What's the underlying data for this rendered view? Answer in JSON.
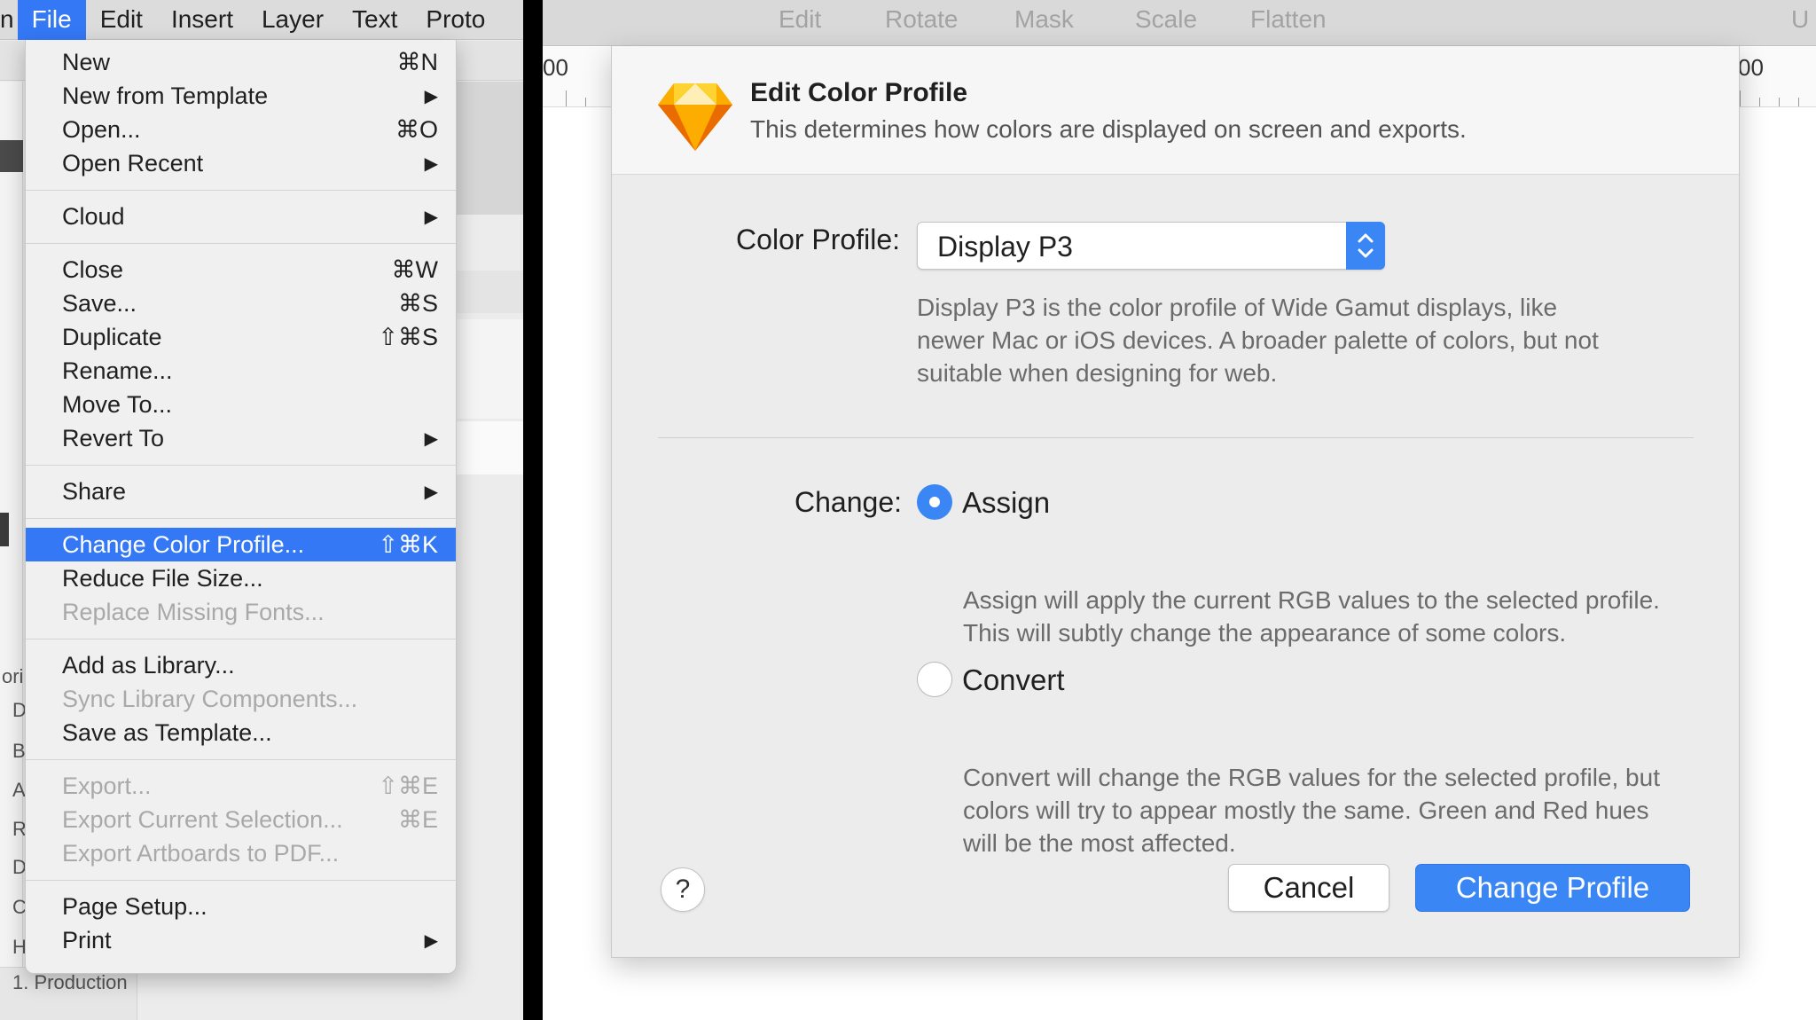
{
  "menubar": {
    "items": [
      {
        "label": "n"
      },
      {
        "label": "File"
      },
      {
        "label": "Edit"
      },
      {
        "label": "Insert"
      },
      {
        "label": "Layer"
      },
      {
        "label": "Text"
      },
      {
        "label": "Proto"
      }
    ]
  },
  "file_menu": {
    "groups": [
      [
        {
          "label": "New",
          "shortcut": "⌘N"
        },
        {
          "label": "New from Template",
          "submenu": "▶"
        },
        {
          "label": "Open...",
          "shortcut": "⌘O"
        },
        {
          "label": "Open Recent",
          "submenu": "▶"
        }
      ],
      [
        {
          "label": "Cloud",
          "submenu": "▶"
        }
      ],
      [
        {
          "label": "Close",
          "shortcut": "⌘W"
        },
        {
          "label": "Save...",
          "shortcut": "⌘S"
        },
        {
          "label": "Duplicate",
          "shortcut": "⇧⌘S"
        },
        {
          "label": "Rename..."
        },
        {
          "label": "Move To..."
        },
        {
          "label": "Revert To",
          "submenu": "▶"
        }
      ],
      [
        {
          "label": "Share",
          "submenu": "▶"
        }
      ],
      [
        {
          "label": "Change Color Profile...",
          "shortcut": "⇧⌘K",
          "highlight": true
        },
        {
          "label": "Reduce File Size..."
        },
        {
          "label": "Replace Missing Fonts...",
          "disabled": true
        }
      ],
      [
        {
          "label": "Add as Library..."
        },
        {
          "label": "Sync Library Components...",
          "disabled": true
        },
        {
          "label": "Save as Template..."
        }
      ],
      [
        {
          "label": "Export...",
          "shortcut": "⇧⌘E",
          "disabled": true
        },
        {
          "label": "Export Current Selection...",
          "shortcut": "⌘E",
          "disabled": true
        },
        {
          "label": "Export Artboards to PDF...",
          "disabled": true
        }
      ],
      [
        {
          "label": "Page Setup..."
        },
        {
          "label": "Print",
          "submenu": "▶"
        }
      ]
    ]
  },
  "background": {
    "layer_fragments": [
      "ori",
      "D",
      "B",
      "A",
      "R",
      "D",
      "C",
      "H"
    ],
    "production_label": "1. Production"
  },
  "toolbar": {
    "items": [
      "Edit",
      "Rotate",
      "Mask",
      "Scale",
      "Flatten",
      "U"
    ]
  },
  "ruler": {
    "left_label": "00",
    "right_label": "00"
  },
  "dialog": {
    "icon": "sketch-diamond-icon",
    "title": "Edit Color Profile",
    "subtitle": "This determines how colors are displayed on screen and exports.",
    "profile_label": "Color Profile:",
    "profile_value": "Display P3",
    "profile_description": "Display P3 is the color profile of Wide Gamut displays, like newer Mac or iOS devices. A broader palette of colors, but not suitable when designing for web.",
    "change_label": "Change:",
    "options": [
      {
        "label": "Assign",
        "selected": true,
        "description": "Assign will apply the current RGB values to the selected profile. This will subtly change the appearance of some colors."
      },
      {
        "label": "Convert",
        "selected": false,
        "description": "Convert will change the RGB values for the selected profile, but colors will try to appear mostly the same. Green and Red hues will be the most affected."
      }
    ],
    "help_label": "?",
    "cancel_label": "Cancel",
    "confirm_label": "Change Profile"
  },
  "colors": {
    "accent": "#3a86f5",
    "menu_highlight": "#3478f6"
  }
}
